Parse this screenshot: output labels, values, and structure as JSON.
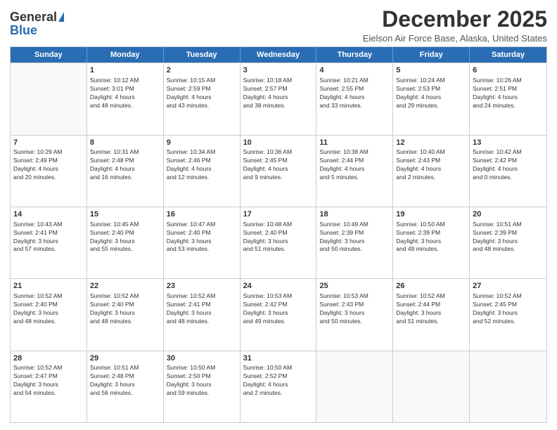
{
  "logo": {
    "general": "General",
    "blue": "Blue"
  },
  "title": "December 2025",
  "location": "Eielson Air Force Base, Alaska, United States",
  "days": [
    "Sunday",
    "Monday",
    "Tuesday",
    "Wednesday",
    "Thursday",
    "Friday",
    "Saturday"
  ],
  "weeks": [
    [
      {
        "num": "",
        "text": ""
      },
      {
        "num": "1",
        "text": "Sunrise: 10:12 AM\nSunset: 3:01 PM\nDaylight: 4 hours\nand 48 minutes."
      },
      {
        "num": "2",
        "text": "Sunrise: 10:15 AM\nSunset: 2:59 PM\nDaylight: 4 hours\nand 43 minutes."
      },
      {
        "num": "3",
        "text": "Sunrise: 10:18 AM\nSunset: 2:57 PM\nDaylight: 4 hours\nand 38 minutes."
      },
      {
        "num": "4",
        "text": "Sunrise: 10:21 AM\nSunset: 2:55 PM\nDaylight: 4 hours\nand 33 minutes."
      },
      {
        "num": "5",
        "text": "Sunrise: 10:24 AM\nSunset: 2:53 PM\nDaylight: 4 hours\nand 29 minutes."
      },
      {
        "num": "6",
        "text": "Sunrise: 10:26 AM\nSunset: 2:51 PM\nDaylight: 4 hours\nand 24 minutes."
      }
    ],
    [
      {
        "num": "7",
        "text": "Sunrise: 10:29 AM\nSunset: 2:49 PM\nDaylight: 4 hours\nand 20 minutes."
      },
      {
        "num": "8",
        "text": "Sunrise: 10:31 AM\nSunset: 2:48 PM\nDaylight: 4 hours\nand 16 minutes."
      },
      {
        "num": "9",
        "text": "Sunrise: 10:34 AM\nSunset: 2:46 PM\nDaylight: 4 hours\nand 12 minutes."
      },
      {
        "num": "10",
        "text": "Sunrise: 10:36 AM\nSunset: 2:45 PM\nDaylight: 4 hours\nand 9 minutes."
      },
      {
        "num": "11",
        "text": "Sunrise: 10:38 AM\nSunset: 2:44 PM\nDaylight: 4 hours\nand 5 minutes."
      },
      {
        "num": "12",
        "text": "Sunrise: 10:40 AM\nSunset: 2:43 PM\nDaylight: 4 hours\nand 2 minutes."
      },
      {
        "num": "13",
        "text": "Sunrise: 10:42 AM\nSunset: 2:42 PM\nDaylight: 4 hours\nand 0 minutes."
      }
    ],
    [
      {
        "num": "14",
        "text": "Sunrise: 10:43 AM\nSunset: 2:41 PM\nDaylight: 3 hours\nand 57 minutes."
      },
      {
        "num": "15",
        "text": "Sunrise: 10:45 AM\nSunset: 2:40 PM\nDaylight: 3 hours\nand 55 minutes."
      },
      {
        "num": "16",
        "text": "Sunrise: 10:47 AM\nSunset: 2:40 PM\nDaylight: 3 hours\nand 53 minutes."
      },
      {
        "num": "17",
        "text": "Sunrise: 10:48 AM\nSunset: 2:40 PM\nDaylight: 3 hours\nand 51 minutes."
      },
      {
        "num": "18",
        "text": "Sunrise: 10:49 AM\nSunset: 2:39 PM\nDaylight: 3 hours\nand 50 minutes."
      },
      {
        "num": "19",
        "text": "Sunrise: 10:50 AM\nSunset: 2:39 PM\nDaylight: 3 hours\nand 49 minutes."
      },
      {
        "num": "20",
        "text": "Sunrise: 10:51 AM\nSunset: 2:39 PM\nDaylight: 3 hours\nand 48 minutes."
      }
    ],
    [
      {
        "num": "21",
        "text": "Sunrise: 10:52 AM\nSunset: 2:40 PM\nDaylight: 3 hours\nand 48 minutes."
      },
      {
        "num": "22",
        "text": "Sunrise: 10:52 AM\nSunset: 2:40 PM\nDaylight: 3 hours\nand 48 minutes."
      },
      {
        "num": "23",
        "text": "Sunrise: 10:52 AM\nSunset: 2:41 PM\nDaylight: 3 hours\nand 48 minutes."
      },
      {
        "num": "24",
        "text": "Sunrise: 10:53 AM\nSunset: 2:42 PM\nDaylight: 3 hours\nand 49 minutes."
      },
      {
        "num": "25",
        "text": "Sunrise: 10:53 AM\nSunset: 2:43 PM\nDaylight: 3 hours\nand 50 minutes."
      },
      {
        "num": "26",
        "text": "Sunrise: 10:52 AM\nSunset: 2:44 PM\nDaylight: 3 hours\nand 51 minutes."
      },
      {
        "num": "27",
        "text": "Sunrise: 10:52 AM\nSunset: 2:45 PM\nDaylight: 3 hours\nand 52 minutes."
      }
    ],
    [
      {
        "num": "28",
        "text": "Sunrise: 10:52 AM\nSunset: 2:47 PM\nDaylight: 3 hours\nand 54 minutes."
      },
      {
        "num": "29",
        "text": "Sunrise: 10:51 AM\nSunset: 2:48 PM\nDaylight: 3 hours\nand 56 minutes."
      },
      {
        "num": "30",
        "text": "Sunrise: 10:50 AM\nSunset: 2:50 PM\nDaylight: 3 hours\nand 59 minutes."
      },
      {
        "num": "31",
        "text": "Sunrise: 10:50 AM\nSunset: 2:52 PM\nDaylight: 4 hours\nand 2 minutes."
      },
      {
        "num": "",
        "text": ""
      },
      {
        "num": "",
        "text": ""
      },
      {
        "num": "",
        "text": ""
      }
    ]
  ]
}
